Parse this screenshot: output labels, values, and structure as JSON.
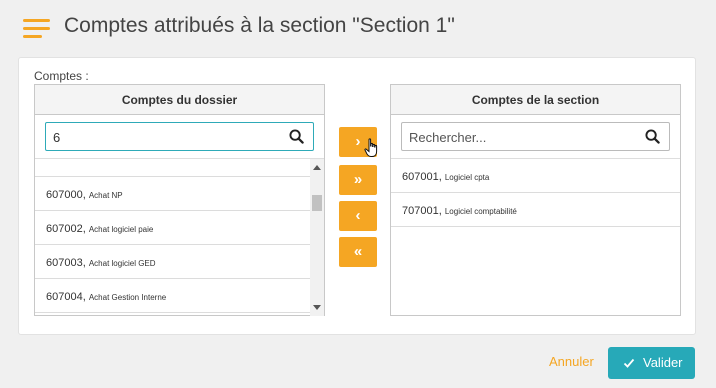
{
  "header": {
    "title": "Comptes attribués à la section \"Section 1\"",
    "icon": "menu-lines-icon"
  },
  "form": {
    "comptes_label": "Comptes :",
    "left_panel": {
      "title": "Comptes du dossier",
      "search_value": "6",
      "items": [
        {
          "code": "607000",
          "label": "Achat NP"
        },
        {
          "code": "607002",
          "label": "Achat logiciel paie"
        },
        {
          "code": "607003",
          "label": "Achat logiciel GED"
        },
        {
          "code": "607004",
          "label": "Achat Gestion Interne"
        }
      ]
    },
    "right_panel": {
      "title": "Comptes de la section",
      "search_placeholder": "Rechercher...",
      "items": [
        {
          "code": "607001",
          "label": "Logiciel cpta"
        },
        {
          "code": "707001",
          "label": "Logiciel comptabilité"
        }
      ]
    },
    "move_buttons": {
      "add_one": "›",
      "add_all": "»",
      "remove_one": "‹",
      "remove_all": "«"
    }
  },
  "footer": {
    "cancel_label": "Annuler",
    "validate_label": "Valider"
  },
  "colors": {
    "accent": "#f5a623",
    "primary": "#27a9b8",
    "focus": "#2eaab8"
  }
}
